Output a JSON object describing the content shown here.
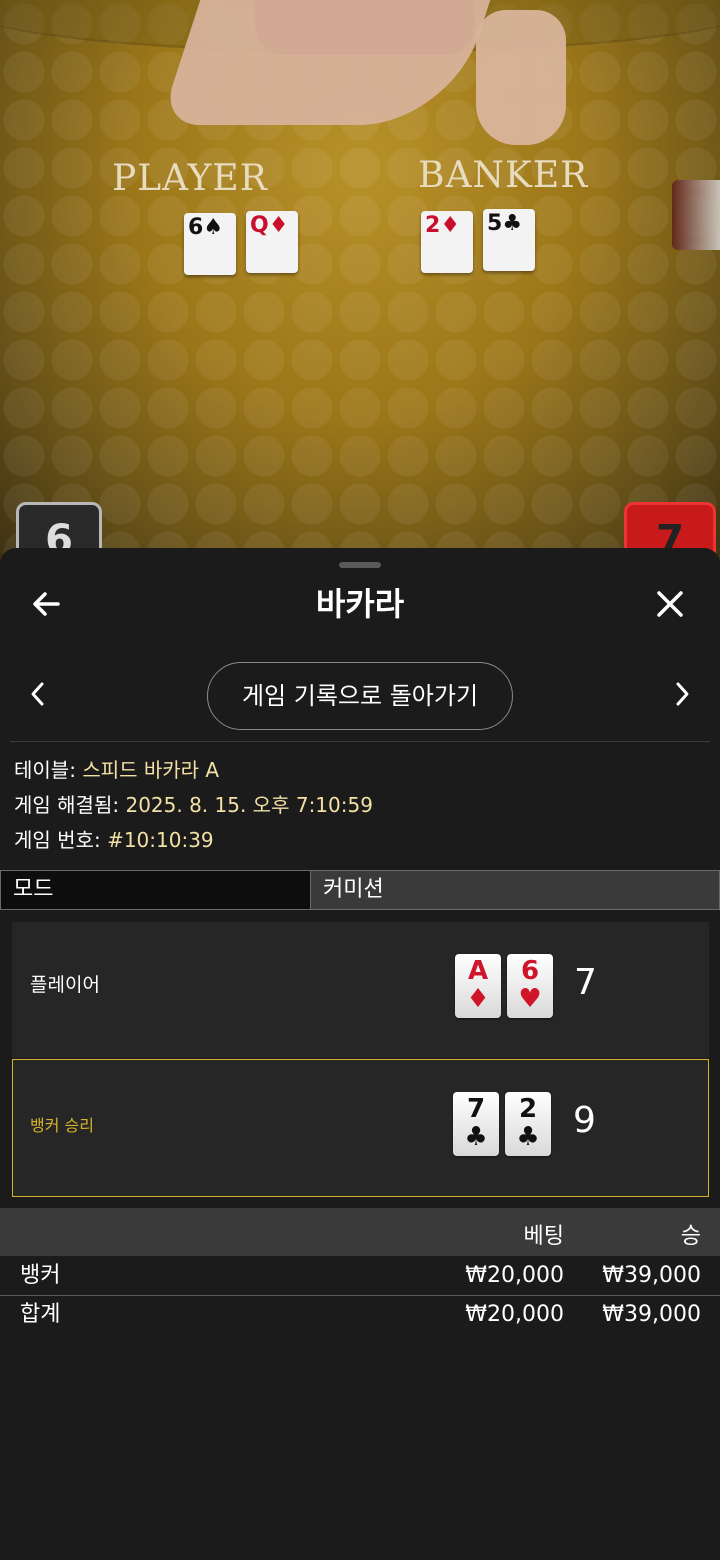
{
  "video": {
    "player_label": "PLAYER",
    "banker_label": "BANKER",
    "player_cards": [
      {
        "rank": "6",
        "suit": "♠",
        "color": "#111111"
      },
      {
        "rank": "Q",
        "suit": "♦",
        "color": "#c8102e"
      }
    ],
    "banker_cards": [
      {
        "rank": "2",
        "suit": "♦",
        "color": "#c8102e"
      },
      {
        "rank": "5",
        "suit": "♣",
        "color": "#111111"
      }
    ],
    "player_score_badge": "6",
    "banker_score_badge": "7"
  },
  "header": {
    "back_icon": "arrow-left-icon",
    "title": "바카라",
    "close_icon": "close-icon"
  },
  "nav": {
    "prev_icon": "chevron-left-icon",
    "next_icon": "chevron-right-icon",
    "return_label": "게임 기록으로 돌아가기"
  },
  "details": {
    "table_label": "테이블:",
    "table_value": "스피드 바카라 A",
    "resolved_label": "게임 해결됨:",
    "resolved_value": "2025. 8. 15. 오후 7:10:59",
    "number_label": "게임 번호:",
    "number_value": "#10:10:39"
  },
  "tabs": {
    "mode": "모드",
    "commission": "커미션"
  },
  "result": {
    "player": {
      "label": "플레이어",
      "cards": [
        {
          "rank": "A",
          "suit": "♦",
          "color": "red"
        },
        {
          "rank": "6",
          "suit": "♥",
          "color": "red"
        }
      ],
      "score": "7"
    },
    "banker": {
      "label": "뱅커 승리",
      "cards": [
        {
          "rank": "7",
          "suit": "♣",
          "color": "black"
        },
        {
          "rank": "2",
          "suit": "♣",
          "color": "black"
        }
      ],
      "score": "9"
    },
    "winner_color": "#d4b42a"
  },
  "bets": {
    "headers": {
      "bet": "베팅",
      "win": "승"
    },
    "rows": [
      {
        "label": "뱅커",
        "bet": "₩20,000",
        "win": "₩39,000"
      }
    ],
    "total": {
      "label": "합계",
      "bet": "₩20,000",
      "win": "₩39,000"
    }
  }
}
